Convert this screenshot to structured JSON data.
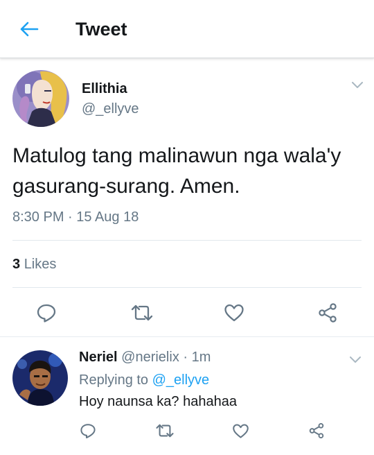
{
  "header": {
    "title": "Tweet",
    "back_icon": "arrow-left-icon",
    "accent_color": "#1da1f2"
  },
  "tweet": {
    "author_name": "Ellithia",
    "author_handle": "@_ellyve",
    "text": "Matulog tang malinawun nga wala'y gasurang-surang. Amen.",
    "timestamp": "8:30 PM · 15 Aug 18",
    "likes_count": "3",
    "likes_label": "Likes",
    "actions": [
      "reply-icon",
      "retweet-icon",
      "heart-icon",
      "share-icon"
    ]
  },
  "reply": {
    "author_name": "Neriel",
    "author_handle": "@nerielix",
    "separator": "·",
    "time_ago": "1m",
    "replying_label": "Replying to",
    "replying_to": "@_ellyve",
    "text": "Hoy naunsa ka? hahahaa",
    "actions": [
      "reply-icon",
      "retweet-icon",
      "heart-icon",
      "share-icon"
    ]
  },
  "colors": {
    "text_primary": "#14171a",
    "text_secondary": "#657786",
    "divider": "#e1e8ed",
    "link": "#1da1f2"
  }
}
